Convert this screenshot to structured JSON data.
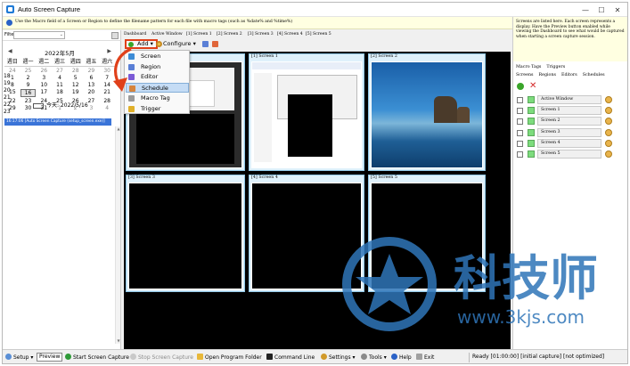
{
  "window": {
    "title": "Auto Screen Capture",
    "min": "—",
    "max": "☐",
    "close": "✕"
  },
  "hint": "Use the Macro field of a Screen or Region to define the filename pattern for each file with macro tags (such as %date% and %time%)",
  "right_hint": "Screens are listed here. Each screen represents a display. Have the Preview button enabled while viewing the Dashboard to see what would be captured when starting a screen capture session.",
  "filter": {
    "label": "Filter",
    "value": "",
    "arrow": "⌄"
  },
  "calendar": {
    "month_title": "2022年5月",
    "prev": "◀",
    "next": "▶",
    "weekdays": [
      "週日",
      "週一",
      "週二",
      "週三",
      "週四",
      "週五",
      "週六"
    ],
    "week_numbers": [
      "18",
      "19",
      "20",
      "21",
      "22",
      "23"
    ],
    "days": [
      [
        "24",
        "25",
        "26",
        "27",
        "28",
        "29",
        "30"
      ],
      [
        "1",
        "2",
        "3",
        "4",
        "5",
        "6",
        "7"
      ],
      [
        "8",
        "9",
        "10",
        "11",
        "12",
        "13",
        "14"
      ],
      [
        "15",
        "16",
        "17",
        "18",
        "19",
        "20",
        "21"
      ],
      [
        "22",
        "23",
        "24",
        "25",
        "26",
        "27",
        "28"
      ],
      [
        "29",
        "30",
        "31",
        "1",
        "2",
        "3",
        "4"
      ]
    ],
    "other_month": [
      [
        1,
        1,
        1,
        1,
        1,
        1,
        1
      ],
      [
        0,
        0,
        0,
        0,
        0,
        0,
        0
      ],
      [
        0,
        0,
        0,
        0,
        0,
        0,
        0
      ],
      [
        0,
        0,
        0,
        0,
        0,
        0,
        0
      ],
      [
        0,
        0,
        0,
        0,
        0,
        0,
        0
      ],
      [
        0,
        0,
        0,
        1,
        1,
        1,
        1
      ]
    ],
    "today_cell": [
      3,
      1
    ],
    "today_label": "今天: 2022/5/16"
  },
  "session_entry": "16:17:06 [Auto Screen Capture (setup_screen.exe)]",
  "tabs": [
    "Dashboard",
    "Active Window",
    "[1] Screen 1",
    "[2] Screen 2",
    "[3] Screen 3",
    "[4] Screen 4",
    "[5] Screen 5"
  ],
  "toolbar": {
    "add_label": "Add",
    "configure_label": "Configure",
    "dropdown_arrow": "▾"
  },
  "add_menu": [
    "Screen",
    "Region",
    "Editor",
    "Schedule",
    "Macro Tag",
    "Trigger"
  ],
  "add_menu_selected": "Schedule",
  "preview_cells": [
    "Active Window",
    "[1] Screen 1",
    "[2] Screen 2",
    "[3] Screen 3",
    "[4] Screen 4",
    "[5] Screen 5"
  ],
  "right_panel": {
    "top_tabs": [
      "Macro Tags",
      "Triggers"
    ],
    "sub_tabs": [
      "Screens",
      "Regions",
      "Editors",
      "Schedules"
    ],
    "items": [
      "Active Window",
      "Screen 1",
      "Screen 2",
      "Screen 3",
      "Screen 4",
      "Screen 5"
    ]
  },
  "statusbar": {
    "setup": "Setup",
    "preview": "Preview",
    "start": "Start Screen Capture",
    "stop": "Stop Screen Capture",
    "open_folder": "Open Program Folder",
    "command_line": "Command Line",
    "settings": "Settings",
    "tools": "Tools",
    "help": "Help",
    "exit": "Exit",
    "status": "Ready [01:00:00] [initial capture] [not optimized]"
  },
  "watermark": {
    "brand": "科技师",
    "url": "www.3kjs.com"
  },
  "colors": {
    "accent_red": "#e0401a",
    "selection_blue": "#3a74d8",
    "cell_border": "#8fc7e6",
    "swatch_green": "#7ddc7d"
  }
}
